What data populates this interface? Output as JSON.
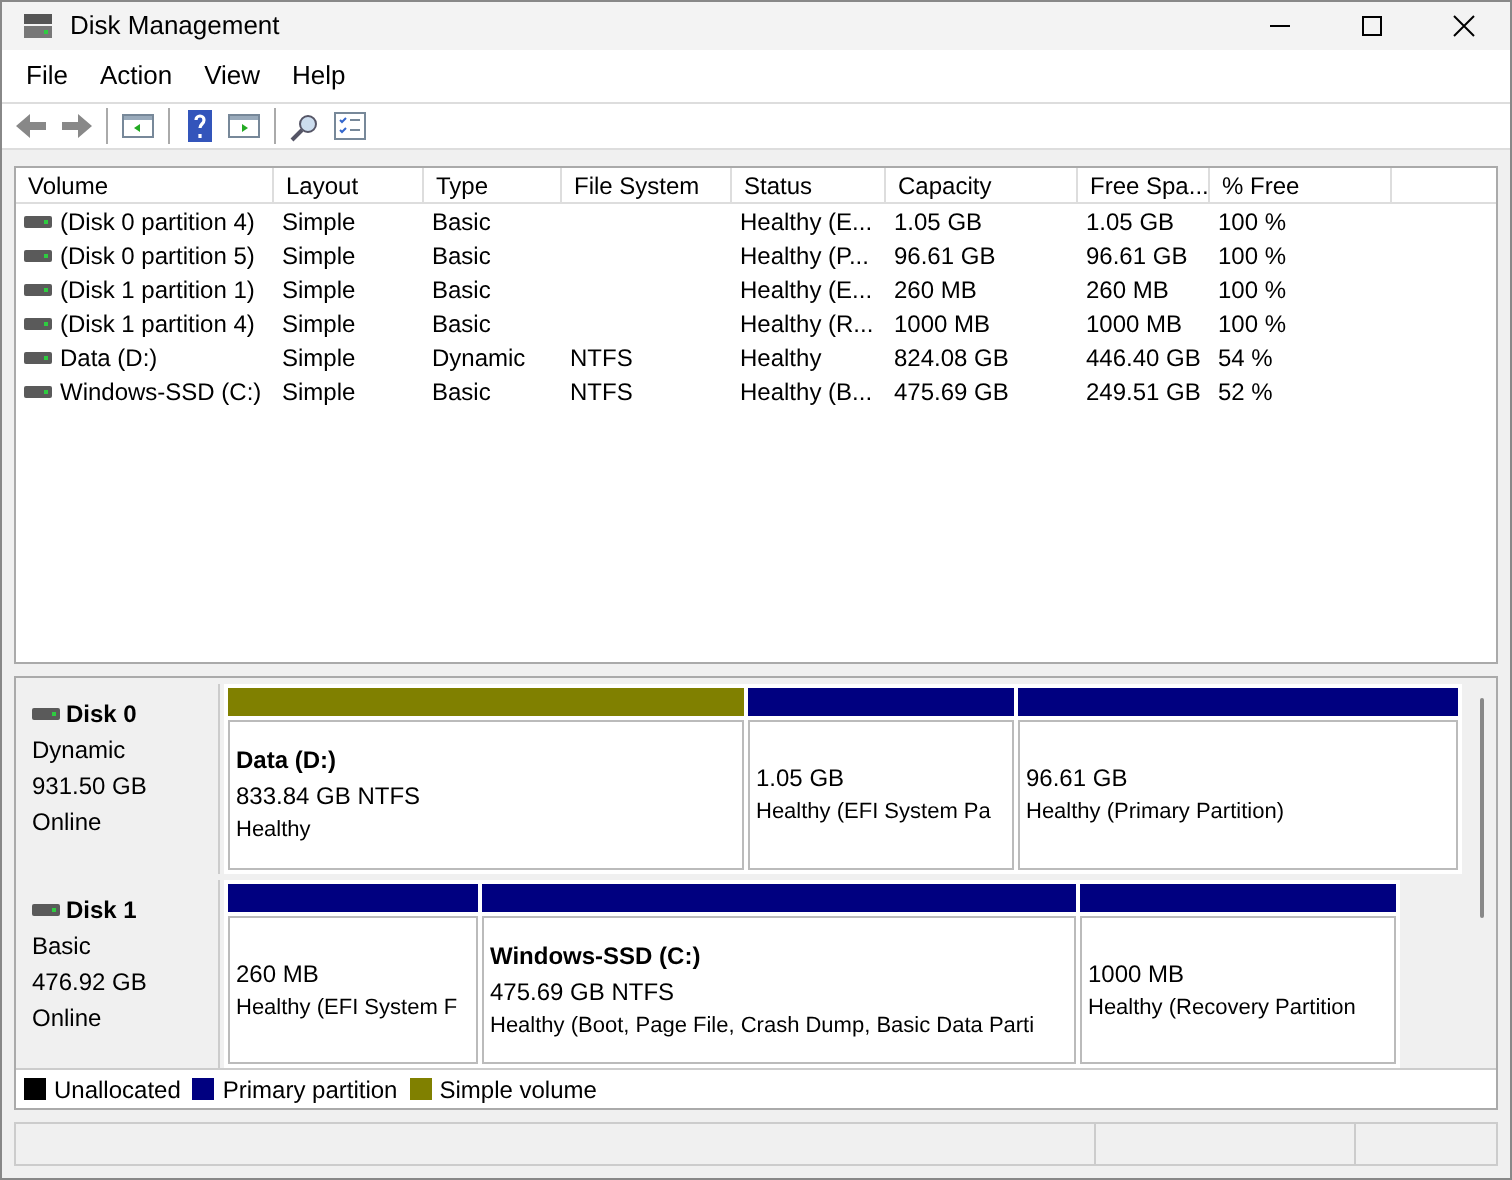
{
  "window": {
    "title": "Disk Management"
  },
  "menu": [
    "File",
    "Action",
    "View",
    "Help"
  ],
  "table": {
    "columns": [
      "Volume",
      "Layout",
      "Type",
      "File System",
      "Status",
      "Capacity",
      "Free Spa...",
      "% Free"
    ],
    "rows": [
      [
        "(Disk 0 partition 4)",
        "Simple",
        "Basic",
        "",
        "Healthy (E...",
        "1.05 GB",
        "1.05 GB",
        "100 %"
      ],
      [
        "(Disk 0 partition 5)",
        "Simple",
        "Basic",
        "",
        "Healthy (P...",
        "96.61 GB",
        "96.61 GB",
        "100 %"
      ],
      [
        "(Disk 1 partition 1)",
        "Simple",
        "Basic",
        "",
        "Healthy (E...",
        "260 MB",
        "260 MB",
        "100 %"
      ],
      [
        "(Disk 1 partition 4)",
        "Simple",
        "Basic",
        "",
        "Healthy (R...",
        "1000 MB",
        "1000 MB",
        "100 %"
      ],
      [
        "Data (D:)",
        "Simple",
        "Dynamic",
        "NTFS",
        "Healthy",
        "824.08 GB",
        "446.40 GB",
        "54 %"
      ],
      [
        "Windows-SSD (C:)",
        "Simple",
        "Basic",
        "NTFS",
        "Healthy (B...",
        "475.69 GB",
        "249.51 GB",
        "52 %"
      ]
    ]
  },
  "disks": [
    {
      "name": "Disk 0",
      "type": "Dynamic",
      "size": "931.50 GB",
      "status": "Online",
      "partitions": [
        {
          "name": "Data  (D:)",
          "size": "833.84 GB NTFS",
          "status": "Healthy",
          "color": "#808000"
        },
        {
          "size": "1.05 GB",
          "status": "Healthy (EFI System Pa",
          "color": "#000080"
        },
        {
          "size": "96.61 GB",
          "status": "Healthy (Primary Partition)",
          "color": "#000080"
        }
      ]
    },
    {
      "name": "Disk 1",
      "type": "Basic",
      "size": "476.92 GB",
      "status": "Online",
      "partitions": [
        {
          "size": "260 MB",
          "status": "Healthy (EFI System F",
          "color": "#000080"
        },
        {
          "name": "Windows-SSD  (C:)",
          "size": "475.69 GB NTFS",
          "status": "Healthy (Boot, Page File, Crash Dump, Basic Data Parti",
          "color": "#000080"
        },
        {
          "size": "1000 MB",
          "status": "Healthy (Recovery Partition",
          "color": "#000080"
        }
      ]
    }
  ],
  "legend": [
    {
      "label": "Unallocated",
      "color": "#000000"
    },
    {
      "label": "Primary partition",
      "color": "#000080"
    },
    {
      "label": "Simple volume",
      "color": "#808000"
    }
  ]
}
